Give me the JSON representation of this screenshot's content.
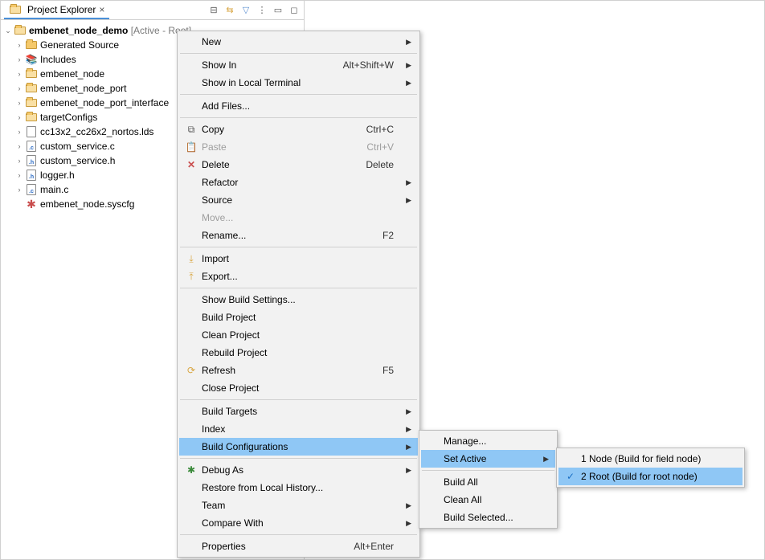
{
  "tab": {
    "title": "Project Explorer"
  },
  "project": {
    "name": "embenet_node_demo",
    "info": "[Active - Root]"
  },
  "tree": [
    {
      "label": "Generated Source",
      "icon": "folder",
      "children": true
    },
    {
      "label": "Includes",
      "icon": "includes",
      "children": true
    },
    {
      "label": "embenet_node",
      "icon": "folder-open",
      "children": true
    },
    {
      "label": "embenet_node_port",
      "icon": "folder-open",
      "children": true
    },
    {
      "label": "embenet_node_port_interface",
      "icon": "folder-open",
      "children": true
    },
    {
      "label": "targetConfigs",
      "icon": "folder-open",
      "children": true
    },
    {
      "label": "cc13x2_cc26x2_nortos.lds",
      "icon": "lds",
      "children": true
    },
    {
      "label": "custom_service.c",
      "icon": "c",
      "children": true
    },
    {
      "label": "custom_service.h",
      "icon": "h",
      "children": true
    },
    {
      "label": "logger.h",
      "icon": "h",
      "children": true
    },
    {
      "label": "main.c",
      "icon": "c",
      "children": true
    },
    {
      "label": "embenet_node.syscfg",
      "icon": "gear",
      "children": false
    }
  ],
  "menu": {
    "groups": [
      [
        {
          "label": "New",
          "arrow": true
        }
      ],
      [
        {
          "label": "Show In",
          "shortcut": "Alt+Shift+W",
          "arrow": true
        },
        {
          "label": "Show in Local Terminal",
          "arrow": true
        }
      ],
      [
        {
          "label": "Add Files..."
        }
      ],
      [
        {
          "label": "Copy",
          "shortcut": "Ctrl+C",
          "icon": "copy"
        },
        {
          "label": "Paste",
          "shortcut": "Ctrl+V",
          "icon": "paste",
          "disabled": true
        },
        {
          "label": "Delete",
          "shortcut": "Delete",
          "icon": "delete"
        },
        {
          "label": "Refactor",
          "arrow": true
        },
        {
          "label": "Source",
          "arrow": true
        },
        {
          "label": "Move...",
          "disabled": true
        },
        {
          "label": "Rename...",
          "shortcut": "F2"
        }
      ],
      [
        {
          "label": "Import",
          "icon": "import"
        },
        {
          "label": "Export...",
          "icon": "export"
        }
      ],
      [
        {
          "label": "Show Build Settings..."
        },
        {
          "label": "Build Project"
        },
        {
          "label": "Clean Project"
        },
        {
          "label": "Rebuild Project"
        },
        {
          "label": "Refresh",
          "shortcut": "F5",
          "icon": "refresh"
        },
        {
          "label": "Close Project"
        }
      ],
      [
        {
          "label": "Build Targets",
          "arrow": true
        },
        {
          "label": "Index",
          "arrow": true
        },
        {
          "label": "Build Configurations",
          "arrow": true,
          "highlight": true
        }
      ],
      [
        {
          "label": "Debug As",
          "icon": "debug",
          "arrow": true
        },
        {
          "label": "Restore from Local History..."
        },
        {
          "label": "Team",
          "arrow": true
        },
        {
          "label": "Compare With",
          "arrow": true
        }
      ],
      [
        {
          "label": "Properties",
          "shortcut": "Alt+Enter"
        }
      ]
    ]
  },
  "submenu1": [
    {
      "label": "Manage..."
    },
    {
      "label": "Set Active",
      "arrow": true,
      "highlight": true
    },
    {
      "sep": true
    },
    {
      "label": "Build All"
    },
    {
      "label": "Clean All"
    },
    {
      "label": "Build Selected..."
    }
  ],
  "submenu2": [
    {
      "label": "1 Node (Build for field node)"
    },
    {
      "label": "2 Root (Build for root node)",
      "highlight": true,
      "checked": true
    }
  ]
}
